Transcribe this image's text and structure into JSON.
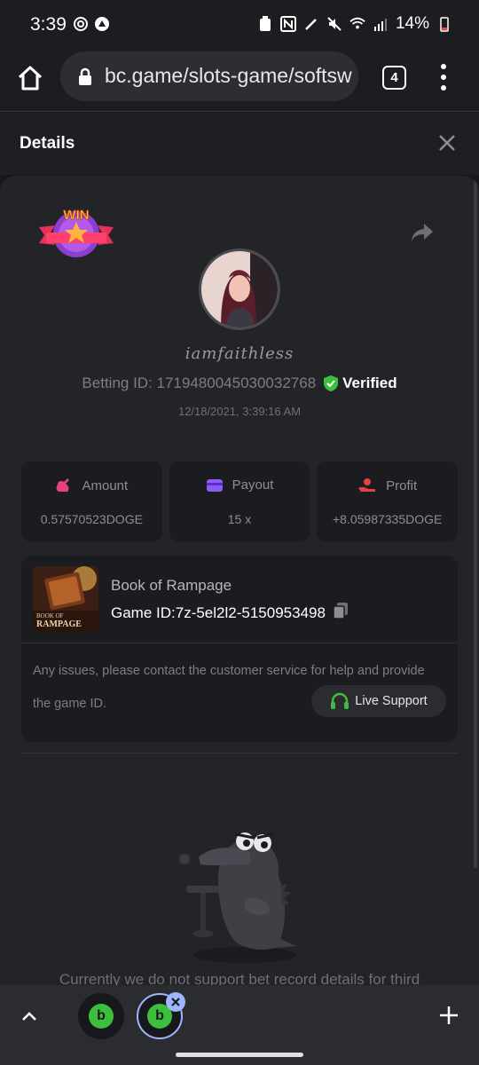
{
  "status_bar": {
    "time": "3:39",
    "battery": "14%"
  },
  "browser": {
    "url": "bc.game/slots-game/softsw",
    "tab_count": "4"
  },
  "dialog": {
    "title": "Details"
  },
  "bet": {
    "username": "iamfaithless",
    "betting_id": "Betting ID: 1719480045030032768",
    "verified_label": "Verified",
    "timestamp": "12/18/2021, 3:39:16 AM"
  },
  "stats": [
    {
      "label": "Amount",
      "value": "0.57570523DOGE",
      "icon": "money-bag-icon",
      "color": "#e8407a"
    },
    {
      "label": "Payout",
      "value": "15 x",
      "icon": "wallet-icon",
      "color": "#8b5cf6"
    },
    {
      "label": "Profit",
      "value": "+8.05987335DOGE",
      "icon": "hand-coin-icon",
      "color": "#e8403f"
    }
  ],
  "game": {
    "name": "Book of Rampage",
    "game_id": "Game ID:7z-5el2l2-5150953498",
    "thumb_text_top": "BOOK OF",
    "thumb_text_bottom": "RAMPAGE"
  },
  "support": {
    "message": "Any issues, please contact the customer service for help and provide the game ID.",
    "button_label": "Live Support"
  },
  "notice": {
    "text": "Currently we do not support bet record details for third"
  },
  "win_badge_text": "WIN",
  "colors": {
    "accent_green": "#3cbf3f",
    "panel": "#232427",
    "card": "#1b1c1f"
  }
}
